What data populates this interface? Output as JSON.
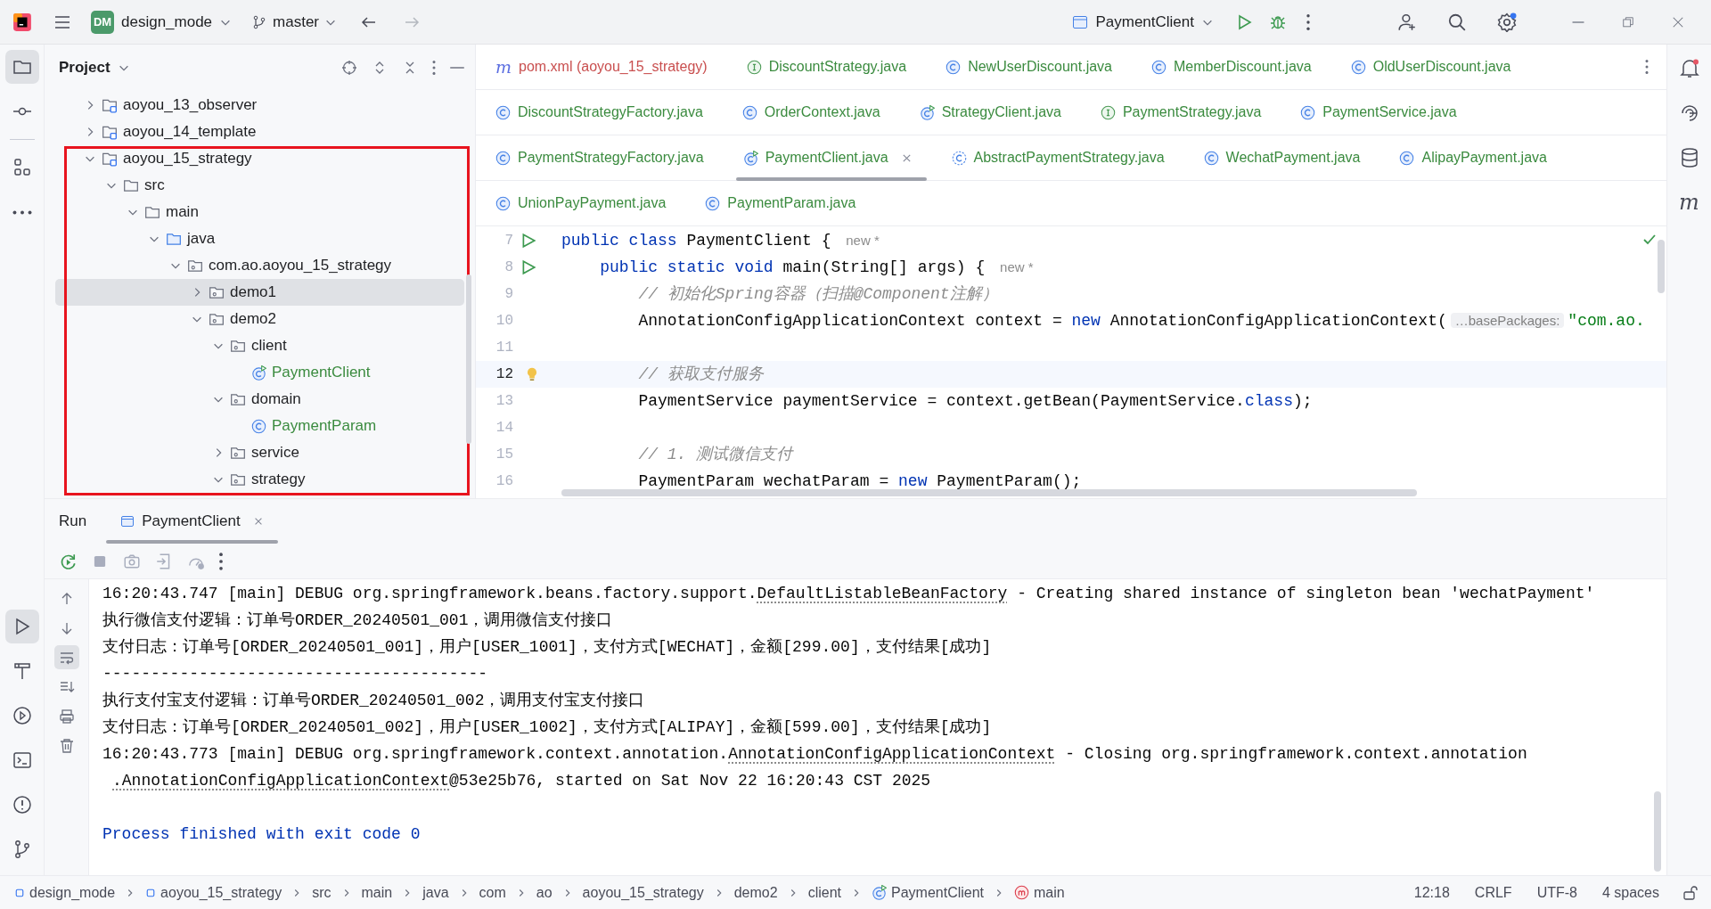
{
  "title_bar": {
    "project_badge": "DM",
    "project": "design_mode",
    "branch": "master",
    "run_config": "PaymentClient"
  },
  "left_toolbar": [
    {
      "kind": "folder",
      "selected": true
    },
    {
      "kind": "commit",
      "selected": false
    },
    {
      "kind": "structure",
      "selected": false
    },
    {
      "kind": "more",
      "selected": false
    }
  ],
  "left_toolbar_bottom": [
    {
      "kind": "run",
      "selected": true
    },
    {
      "kind": "build",
      "selected": false
    },
    {
      "kind": "services",
      "selected": false
    },
    {
      "kind": "terminal",
      "selected": false
    },
    {
      "kind": "problems",
      "selected": false
    },
    {
      "kind": "git",
      "selected": false
    }
  ],
  "project_panel": {
    "title": "Project",
    "tree": [
      {
        "label": "aoyou_13_observer",
        "kind": "module",
        "expanded": false,
        "selected": false
      },
      {
        "label": "aoyou_14_template",
        "kind": "module",
        "expanded": false,
        "selected": false
      },
      {
        "label": "aoyou_15_strategy",
        "kind": "module",
        "expanded": true,
        "selected": false,
        "children": [
          {
            "label": "src",
            "kind": "folder",
            "expanded": true,
            "selected": false,
            "children": [
              {
                "label": "main",
                "kind": "folder",
                "expanded": true,
                "selected": false,
                "children": [
                  {
                    "label": "java",
                    "kind": "source",
                    "expanded": true,
                    "selected": false,
                    "children": [
                      {
                        "label": "com.ao.aoyou_15_strategy",
                        "kind": "package",
                        "expanded": true,
                        "selected": false,
                        "children": [
                          {
                            "label": "demo1",
                            "kind": "package",
                            "expanded": false,
                            "selected": true
                          },
                          {
                            "label": "demo2",
                            "kind": "package",
                            "expanded": true,
                            "selected": false,
                            "children": [
                              {
                                "label": "client",
                                "kind": "package",
                                "expanded": true,
                                "selected": false,
                                "children": [
                                  {
                                    "label": "PaymentClient",
                                    "kind": "runnable",
                                    "color": "#3b8b3f",
                                    "selected": false
                                  }
                                ]
                              },
                              {
                                "label": "domain",
                                "kind": "package",
                                "expanded": true,
                                "selected": false,
                                "children": [
                                  {
                                    "label": "PaymentParam",
                                    "kind": "class",
                                    "color": "#3b8b3f",
                                    "selected": false
                                  }
                                ]
                              },
                              {
                                "label": "service",
                                "kind": "package",
                                "expanded": false,
                                "selected": false
                              },
                              {
                                "label": "strategy",
                                "kind": "package",
                                "expanded": true,
                                "selected": false
                              }
                            ]
                          }
                        ]
                      }
                    ]
                  }
                ]
              }
            ]
          }
        ]
      }
    ]
  },
  "editor_tabs": [
    [
      {
        "label": "pom.xml (aoyou_15_strategy)",
        "kind": "maven",
        "glyph": "m",
        "color": "#c94f4f",
        "selected": false
      },
      {
        "label": "DiscountStrategy.java",
        "kind": "interface",
        "color": "#3b8b3f",
        "selected": false
      },
      {
        "label": "NewUserDiscount.java",
        "kind": "class",
        "color": "#3b8b3f",
        "selected": false
      },
      {
        "label": "MemberDiscount.java",
        "kind": "class",
        "color": "#3b8b3f",
        "selected": false
      },
      {
        "label": "OldUserDiscount.java",
        "kind": "class",
        "color": "#3b8b3f",
        "selected": false
      }
    ],
    [
      {
        "label": "DiscountStrategyFactory.java",
        "kind": "class",
        "color": "#3b8b3f",
        "selected": false
      },
      {
        "label": "OrderContext.java",
        "kind": "class",
        "color": "#3b8b3f",
        "selected": false
      },
      {
        "label": "StrategyClient.java",
        "kind": "runnable",
        "color": "#3b8b3f",
        "selected": false
      },
      {
        "label": "PaymentStrategy.java",
        "kind": "interface",
        "color": "#3b8b3f",
        "selected": false
      },
      {
        "label": "PaymentService.java",
        "kind": "class",
        "color": "#3b8b3f",
        "selected": false
      }
    ],
    [
      {
        "label": "PaymentStrategyFactory.java",
        "kind": "class",
        "color": "#3b8b3f",
        "selected": false
      },
      {
        "label": "PaymentClient.java",
        "kind": "runnable",
        "color": "#3b8b3f",
        "selected": true
      },
      {
        "label": "AbstractPaymentStrategy.java",
        "kind": "abstract",
        "color": "#3b8b3f",
        "selected": false
      },
      {
        "label": "WechatPayment.java",
        "kind": "class",
        "color": "#3b8b3f",
        "selected": false
      },
      {
        "label": "AlipayPayment.java",
        "kind": "class",
        "color": "#3b8b3f",
        "selected": false
      }
    ],
    [
      {
        "label": "UnionPayPayment.java",
        "kind": "class",
        "color": "#3b8b3f",
        "selected": false
      },
      {
        "label": "PaymentParam.java",
        "kind": "class",
        "color": "#3b8b3f",
        "selected": false
      }
    ]
  ],
  "editor": {
    "lines": [
      {
        "number": "7",
        "run": true,
        "current": false,
        "bulb": false,
        "segments": [
          {
            "text": "public class",
            "kind": "keyword"
          },
          {
            "text": " PaymentClient { ",
            "kind": "plain"
          },
          {
            "text": "new *",
            "kind": "hint"
          }
        ]
      },
      {
        "number": "8",
        "run": true,
        "current": false,
        "bulb": false,
        "segments": [
          {
            "text": "    public static void",
            "kind": "keyword"
          },
          {
            "text": " main(String[] args) { ",
            "kind": "plain"
          },
          {
            "text": "new *",
            "kind": "hint"
          }
        ]
      },
      {
        "number": "9",
        "run": false,
        "current": false,
        "bulb": false,
        "segments": [
          {
            "text": "        // 初始化Spring容器（扫描@Component注解）",
            "kind": "comment"
          }
        ]
      },
      {
        "number": "10",
        "run": false,
        "current": false,
        "bulb": false,
        "segments": [
          {
            "text": "        AnnotationConfigApplicationContext context = ",
            "kind": "plain"
          },
          {
            "text": "new",
            "kind": "keyword"
          },
          {
            "text": " AnnotationConfigApplicationContext(",
            "kind": "plain"
          },
          {
            "text": "…basePackages:",
            "kind": "inlay"
          },
          {
            "text": "\"com.ao.",
            "kind": "string"
          }
        ]
      },
      {
        "number": "11",
        "run": false,
        "current": false,
        "bulb": false
      },
      {
        "number": "12",
        "run": false,
        "current": true,
        "bulb": true,
        "segments": [
          {
            "text": "        // 获取支付服务",
            "kind": "comment"
          }
        ]
      },
      {
        "number": "13",
        "run": false,
        "current": false,
        "bulb": false,
        "segments": [
          {
            "text": "        PaymentService paymentService = context.getBean(PaymentService.",
            "kind": "plain"
          },
          {
            "text": "class",
            "kind": "keyword"
          },
          {
            "text": ");",
            "kind": "plain"
          }
        ]
      },
      {
        "number": "14",
        "run": false,
        "current": false,
        "bulb": false
      },
      {
        "number": "15",
        "run": false,
        "current": false,
        "bulb": false,
        "segments": [
          {
            "text": "        // 1. 测试微信支付",
            "kind": "comment"
          }
        ]
      },
      {
        "number": "16",
        "run": false,
        "current": false,
        "bulb": false,
        "segments": [
          {
            "text": "        PaymentParam wechatParam = ",
            "kind": "plain"
          },
          {
            "text": "new",
            "kind": "keyword"
          },
          {
            "text": " PaymentParam();",
            "kind": "plain"
          }
        ]
      }
    ]
  },
  "run_panel": {
    "title": "Run",
    "tab": {
      "label": "PaymentClient",
      "selected": true
    },
    "console": [
      {
        "kind": "log",
        "segments": [
          {
            "text": "16:20:43.747 [main] DEBUG org.springframework.beans.factory.support.",
            "kind": "plain"
          },
          {
            "text": "DefaultListableBeanFactory",
            "kind": "link"
          },
          {
            "text": " - Creating shared instance of singleton bean 'wechatPayment'",
            "kind": "plain"
          }
        ]
      },
      {
        "kind": "log",
        "segments": [
          {
            "text": "执行微信支付逻辑：订单号ORDER_20240501_001，调用微信支付接口",
            "kind": "plain"
          }
        ]
      },
      {
        "kind": "log",
        "segments": [
          {
            "text": "支付日志：订单号[ORDER_20240501_001]，用户[USER_1001]，支付方式[WECHAT]，金额[299.00]，支付结果[成功]",
            "kind": "plain"
          }
        ]
      },
      {
        "kind": "log",
        "segments": [
          {
            "text": "----------------------------------------",
            "kind": "plain"
          }
        ]
      },
      {
        "kind": "log",
        "segments": [
          {
            "text": "执行支付宝支付逻辑：订单号ORDER_20240501_002，调用支付宝支付接口",
            "kind": "plain"
          }
        ]
      },
      {
        "kind": "log",
        "segments": [
          {
            "text": "支付日志：订单号[ORDER_20240501_002]，用户[USER_1002]，支付方式[ALIPAY]，金额[599.00]，支付结果[成功]",
            "kind": "plain"
          }
        ]
      },
      {
        "kind": "log",
        "segments": [
          {
            "text": "16:20:43.773 [main] DEBUG org.springframework.context.annotation.",
            "kind": "plain"
          },
          {
            "text": "AnnotationConfigApplicationContext",
            "kind": "link"
          },
          {
            "text": " - Closing org.springframework.context.annotation",
            "kind": "plain"
          }
        ]
      },
      {
        "kind": "continuation",
        "segments": [
          {
            "text": ".AnnotationConfigApplicationContext",
            "kind": "link"
          },
          {
            "text": "@53e25b76, started on Sat Nov 22 16:20:43 CST 2025",
            "kind": "plain"
          }
        ]
      },
      {
        "kind": "exit",
        "segments": [
          {
            "text": "Process finished with exit code 0",
            "kind": "plain"
          }
        ]
      }
    ]
  },
  "status_bar": {
    "breadcrumbs": [
      {
        "label": "design_mode",
        "kind": "module"
      },
      {
        "label": "aoyou_15_strategy",
        "kind": "module"
      },
      {
        "label": "src"
      },
      {
        "label": "main"
      },
      {
        "label": "java"
      },
      {
        "label": "com"
      },
      {
        "label": "ao"
      },
      {
        "label": "aoyou_15_strategy"
      },
      {
        "label": "demo2"
      },
      {
        "label": "client"
      },
      {
        "label": "PaymentClient",
        "kind": "runnable"
      },
      {
        "label": "main",
        "kind": "method"
      }
    ],
    "caret": "12:18",
    "line_separator": "CRLF",
    "encoding": "UTF-8",
    "indent": "4 spaces"
  },
  "right_toolbar": [
    {
      "kind": "notifications"
    },
    {
      "kind": "ai"
    },
    {
      "kind": "database"
    },
    {
      "kind": "maven",
      "glyph": "m"
    }
  ]
}
